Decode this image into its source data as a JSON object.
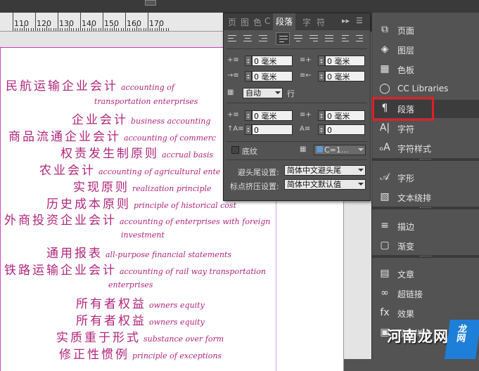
{
  "ruler": {
    "labels": [
      "110",
      "120",
      "130",
      "140",
      "150",
      "160",
      "170"
    ]
  },
  "document": {
    "lines": [
      {
        "zh": "民航运输企业会计",
        "en": "accounting of"
      },
      {
        "zh": "",
        "en": "transportation enterprises"
      },
      {
        "zh": "企业会计",
        "en": "business accounting"
      },
      {
        "zh": "商品流通企业会计",
        "en": "accounting of commerc"
      },
      {
        "zh": "权责发生制原则",
        "en": "accrual basis"
      },
      {
        "zh": "农业会计",
        "en": "accounting of agricultural ente"
      },
      {
        "zh": "实现原则",
        "en": "realization principle"
      },
      {
        "zh": "历史成本原则",
        "en": "principle of historical cost"
      },
      {
        "zh": "外商投资企业会计",
        "en": "accounting of enterprises with foreign"
      },
      {
        "zh": "",
        "en": "investment"
      },
      {
        "zh": "通用报表",
        "en": "all-purpose financial statements"
      },
      {
        "zh": "铁路运输企业会计",
        "en": "accounting of rail way transportation"
      },
      {
        "zh": "",
        "en": "enterprises"
      },
      {
        "zh": "所有者权益",
        "en": "owners equity"
      },
      {
        "zh": "所有者权益",
        "en": "owners equity"
      },
      {
        "zh": "实质重于形式",
        "en": "substance over form"
      },
      {
        "zh": "修正性惯例",
        "en": "principle of exceptions"
      }
    ]
  },
  "paragraph_panel": {
    "tabs": [
      "页",
      "图",
      "色",
      "C",
      "段落",
      "字",
      "符"
    ],
    "active_tab": "段落",
    "left_indent": "0 毫米",
    "right_indent": "0 毫米",
    "first_line_indent": "0 毫米",
    "last_line_indent": "0 毫米",
    "auto_label": "自动",
    "line_label": "行",
    "space_before": "0 毫米",
    "space_after": "0 毫米",
    "drop_cap_lines": "0",
    "drop_cap_chars": "0",
    "shading_label": "底纹",
    "shading_swatch": "C=1...",
    "kinsoku_label": "避头尾设置:",
    "kinsoku_value": "简体中文避头尾",
    "mojikumi_label": "标点挤压设置:",
    "mojikumi_value": "简体中文默认值"
  },
  "dock": {
    "items": [
      {
        "icon": "pages-icon",
        "label": "页面"
      },
      {
        "icon": "layers-icon",
        "label": "图层"
      },
      {
        "icon": "swatches-icon",
        "label": "色板"
      },
      {
        "icon": "cc-libraries-icon",
        "label": "CC Libraries"
      },
      {
        "icon": "paragraph-icon",
        "label": "段落"
      },
      {
        "icon": "character-icon",
        "label": "字符"
      },
      {
        "icon": "character-styles-icon",
        "label": "字符样式"
      },
      {
        "icon": "glyphs-icon",
        "label": "字形"
      },
      {
        "icon": "text-wrap-icon",
        "label": "文本绕排"
      },
      {
        "icon": "stroke-icon",
        "label": "描边"
      },
      {
        "icon": "gradient-icon",
        "label": "渐变"
      },
      {
        "icon": "article-icon",
        "label": "文章"
      },
      {
        "icon": "hyperlink-icon",
        "label": "超链接"
      },
      {
        "icon": "effects-icon",
        "label": "效果"
      },
      {
        "icon": "object-styles-icon",
        "label": "段落样式"
      }
    ]
  },
  "watermark": {
    "text": "河南龙网",
    "badge": "龙网"
  },
  "colors": {
    "handwriting": "#b0257b",
    "highlight": "#e21f26",
    "panel_bg": "#535353"
  }
}
